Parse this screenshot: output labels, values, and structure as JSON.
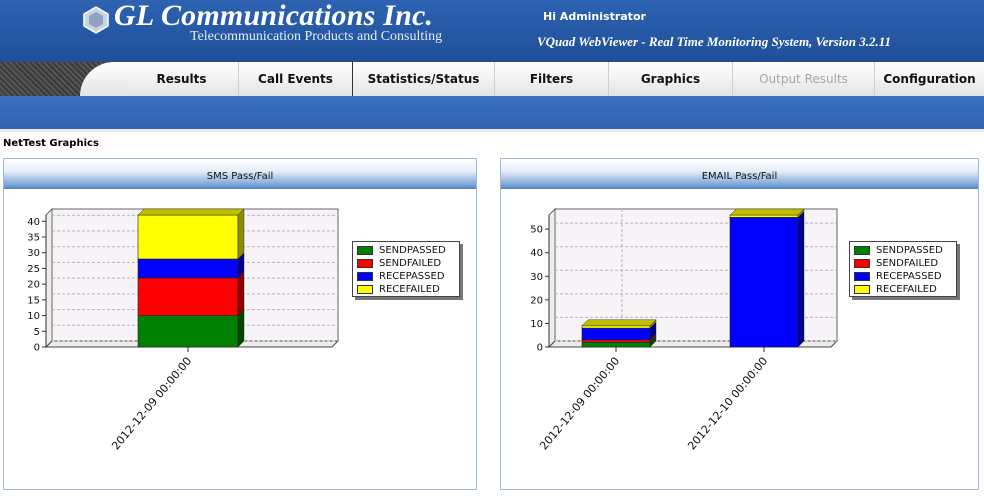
{
  "header": {
    "brand_title": "GL Communications Inc.",
    "brand_subtitle": "Telecommunication Products and Consulting",
    "greeting": "Hi Administrator",
    "app_version": "VQuad WebViewer - Real Time Monitoring System, Version 3.2.11",
    "logo_icon": "gl-logo-icon"
  },
  "nav": {
    "items": [
      {
        "label": "Results",
        "state": "normal"
      },
      {
        "label": "Call Events",
        "state": "active"
      },
      {
        "label": "Statistics/Status",
        "state": "normal"
      },
      {
        "label": "Filters",
        "state": "normal"
      },
      {
        "label": "Graphics",
        "state": "normal"
      },
      {
        "label": "Output Results",
        "state": "disabled"
      },
      {
        "label": "Configuration",
        "state": "normal"
      }
    ]
  },
  "page": {
    "title": "NetTest Graphics"
  },
  "colors": {
    "header_blue": "#2a5aa8",
    "sendpassed": "#008000",
    "sendfailed": "#ff0000",
    "recepassed": "#0000ff",
    "recefailed": "#ffff00"
  },
  "chart_data": [
    {
      "type": "bar",
      "stacked": true,
      "title": "SMS Pass/Fail",
      "categories": [
        "2012-12-09 00:00:00"
      ],
      "series": [
        {
          "name": "SENDPASSED",
          "values": [
            10
          ],
          "color": "#008000"
        },
        {
          "name": "SENDFAILED",
          "values": [
            12
          ],
          "color": "#ff0000"
        },
        {
          "name": "RECEPASSED",
          "values": [
            6
          ],
          "color": "#0000ff"
        },
        {
          "name": "RECEFAILED",
          "values": [
            14
          ],
          "color": "#ffff00"
        }
      ],
      "yticks": [
        0,
        5,
        10,
        15,
        20,
        25,
        30,
        35,
        40
      ],
      "ylim": [
        0,
        42
      ],
      "grid": true,
      "legend": "right"
    },
    {
      "type": "bar",
      "stacked": true,
      "title": "EMAIL Pass/Fail",
      "categories": [
        "2012-12-09 00:00:00",
        "2012-12-10 00:00:00"
      ],
      "series": [
        {
          "name": "SENDPASSED",
          "values": [
            2,
            0
          ],
          "color": "#008000"
        },
        {
          "name": "SENDFAILED",
          "values": [
            1,
            0
          ],
          "color": "#ff0000"
        },
        {
          "name": "RECEPASSED",
          "values": [
            5,
            55
          ],
          "color": "#0000ff"
        },
        {
          "name": "RECEFAILED",
          "values": [
            1,
            1
          ],
          "color": "#ffff00"
        }
      ],
      "yticks": [
        0,
        10,
        20,
        30,
        40,
        50
      ],
      "ylim": [
        0,
        56
      ],
      "grid": true,
      "legend": "right"
    }
  ]
}
